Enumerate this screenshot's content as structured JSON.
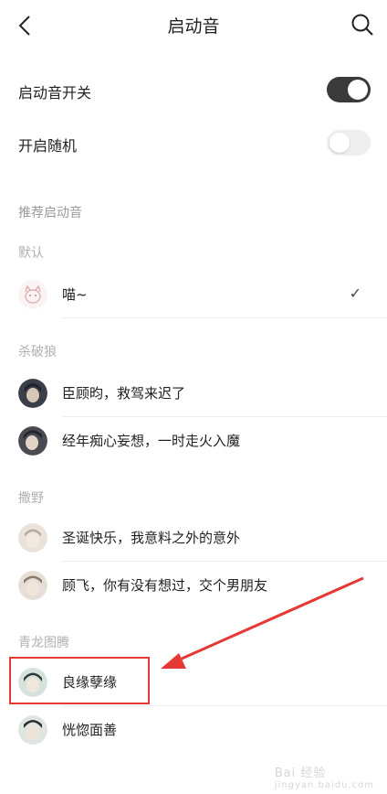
{
  "header": {
    "title": "启动音"
  },
  "settings": {
    "master_switch": {
      "label": "启动音开关",
      "on": true
    },
    "random": {
      "label": "开启随机",
      "on": false
    }
  },
  "section_title": "推荐启动音",
  "groups": [
    {
      "title": "默认",
      "items": [
        {
          "name": "喵~",
          "selected": true
        }
      ]
    },
    {
      "title": "杀破狼",
      "items": [
        {
          "name": "臣顾昀，救驾来迟了"
        },
        {
          "name": "经年痴心妄想，一时走火入魔"
        }
      ]
    },
    {
      "title": "撒野",
      "items": [
        {
          "name": "圣诞快乐，我意料之外的意外"
        },
        {
          "name": "顾飞，你有没有想过，交个男朋友"
        }
      ]
    },
    {
      "title": "青龙图腾",
      "items": [
        {
          "name": "良缘孽缘"
        },
        {
          "name": "恍惚面善"
        }
      ]
    }
  ],
  "watermark": {
    "text": "Bai 经验",
    "sub": "jingyan.baidu.com"
  },
  "colors": {
    "toggle_on": "#3a3a3a",
    "annotation": "#e53935"
  }
}
